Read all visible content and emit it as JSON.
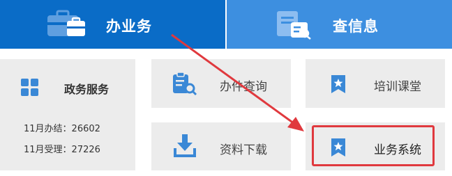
{
  "tabs": [
    {
      "label": "办业务",
      "icon": "briefcase-icon",
      "active": true
    },
    {
      "label": "查信息",
      "icon": "document-search-icon",
      "active": false
    }
  ],
  "gov_services": {
    "title": "政务服务",
    "icon": "grid-icon",
    "stats": [
      {
        "text": "11月办结：26602"
      },
      {
        "text": "11月受理：27226"
      }
    ]
  },
  "tiles": {
    "query": {
      "label": "办件查询",
      "icon": "clipboard-search-icon"
    },
    "download": {
      "label": "资料下载",
      "icon": "download-icon"
    },
    "training": {
      "label": "培训课堂",
      "icon": "bookmark-star-icon"
    },
    "system": {
      "label": "业务系统",
      "icon": "bookmark-star-icon"
    }
  },
  "colors": {
    "tab_active": "#0a6cc7",
    "tab_inactive": "#3d8fe0",
    "tile_bg": "#ececec",
    "icon_blue": "#3a88d6",
    "highlight_red": "#e0393e"
  }
}
